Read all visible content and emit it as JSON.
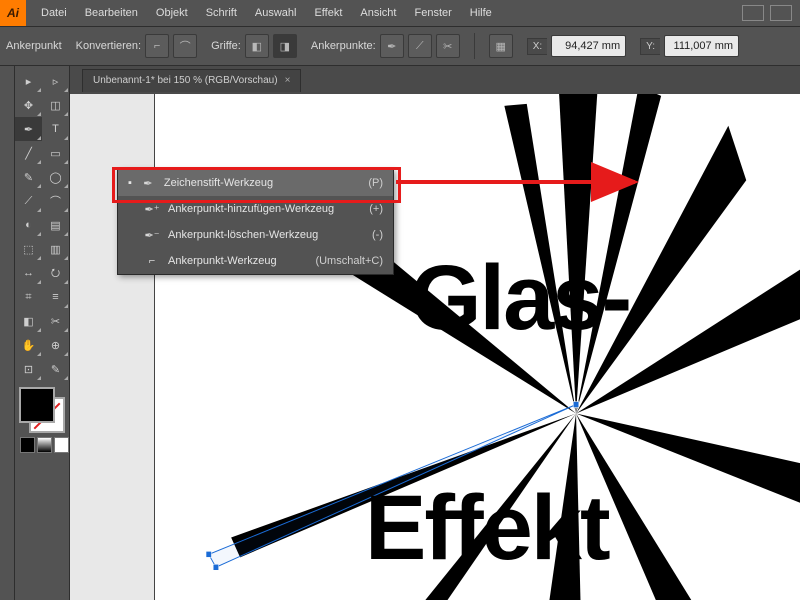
{
  "app_logo": "Ai",
  "menu": [
    "Datei",
    "Bearbeiten",
    "Objekt",
    "Schrift",
    "Auswahl",
    "Effekt",
    "Ansicht",
    "Fenster",
    "Hilfe"
  ],
  "options": {
    "context": "Ankerpunkt",
    "convert": "Konvertieren:",
    "handles": "Griffe:",
    "anchors": "Ankerpunkte:",
    "x_label": "X:",
    "y_label": "Y:",
    "x_val": "94,427 mm",
    "y_val": "111,007 mm"
  },
  "doc_tab": {
    "title": "Unbenannt-1* bei 150 % (RGB/Vorschau)",
    "close": "×"
  },
  "flyout": [
    {
      "icon": "✒",
      "label": "Zeichenstift-Werkzeug",
      "shortcut": "(P)",
      "hl": true
    },
    {
      "icon": "✒⁺",
      "label": "Ankerpunkt-hinzufügen-Werkzeug",
      "shortcut": "(+)",
      "hl": false
    },
    {
      "icon": "✒⁻",
      "label": "Ankerpunkt-löschen-Werkzeug",
      "shortcut": "(-)",
      "hl": false
    },
    {
      "icon": "⌐",
      "label": "Ankerpunkt-Werkzeug",
      "shortcut": "(Umschalt+C)",
      "hl": false
    }
  ],
  "canvas": {
    "text1": "Glas-",
    "text2": "Effekt"
  },
  "tool_glyphs": [
    [
      "▸",
      "▹"
    ],
    [
      "✥",
      "◫"
    ],
    [
      "✒",
      "T"
    ],
    [
      "╱",
      "▭"
    ],
    [
      "✎",
      "◯"
    ],
    [
      "⟋",
      "⌒"
    ],
    [
      "◐",
      "▤"
    ],
    [
      "⬚",
      "▥"
    ],
    [
      "↔",
      "⭮"
    ],
    [
      "⌗",
      "≡"
    ],
    [
      "◧",
      "✂"
    ],
    [
      "✋",
      "⊕"
    ],
    [
      "⊡",
      "✎"
    ]
  ]
}
